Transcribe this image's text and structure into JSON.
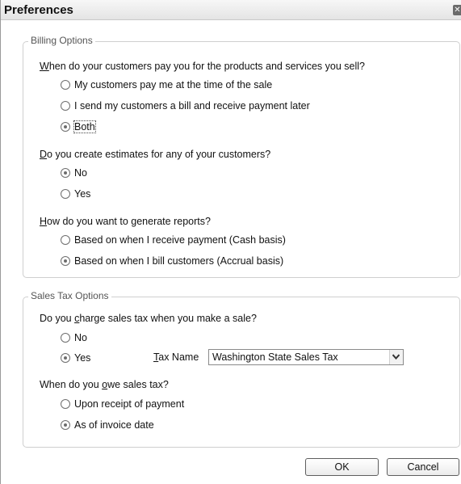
{
  "window": {
    "title": "Preferences",
    "close_glyph": "✕"
  },
  "billing": {
    "legend": "Billing Options",
    "q1": {
      "text_u": "W",
      "text_rest": "hen do your customers pay you for the products and services you sell?",
      "options": [
        "My customers pay me at the time of the sale",
        "I send my customers a bill and receive payment later",
        "Both"
      ],
      "selected": 2
    },
    "q2": {
      "text_u": "D",
      "text_rest": "o you create estimates for any of your customers?",
      "options": [
        "No",
        "Yes"
      ],
      "selected": 0
    },
    "q3": {
      "text_u": "H",
      "text_rest": "ow do you want to generate reports?",
      "options": [
        "Based on when I receive payment (Cash basis)",
        "Based on when I bill customers (Accrual basis)"
      ],
      "selected": 1
    }
  },
  "sales_tax": {
    "legend": "Sales Tax Options",
    "q1": {
      "text_pre": "Do you ",
      "text_u": "c",
      "text_rest": "harge sales tax when you make a sale?",
      "options": [
        "No",
        "Yes"
      ],
      "selected": 1
    },
    "tax_name": {
      "label_u": "T",
      "label_rest": "ax Name",
      "value": "Washington State Sales Tax"
    },
    "q2": {
      "text_pre": "When do you ",
      "text_u": "o",
      "text_rest": "we sales tax?",
      "options": [
        "Upon receipt of payment",
        "As of invoice date"
      ],
      "selected": 1
    }
  },
  "buttons": {
    "ok": "OK",
    "cancel": "Cancel"
  },
  "icons": {
    "close": "close-icon",
    "dropdown": "chevron-down-icon"
  }
}
